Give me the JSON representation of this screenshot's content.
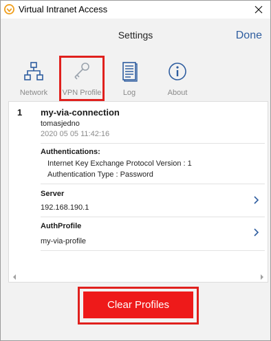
{
  "window": {
    "title": "Virtual Intranet Access"
  },
  "header": {
    "title": "Settings",
    "done_label": "Done"
  },
  "nav": {
    "tabs": [
      {
        "label": "Network",
        "icon": "network-icon"
      },
      {
        "label": "VPN Profile",
        "icon": "key-icon"
      },
      {
        "label": "Log",
        "icon": "log-icon"
      },
      {
        "label": "About",
        "icon": "info-icon"
      }
    ],
    "selected": "VPN Profile"
  },
  "profile": {
    "index": "1",
    "name": "my-via-connection",
    "user": "tomasjedno",
    "date": "2020 05 05 11:42:16",
    "authentications": {
      "heading": "Authentications:",
      "lines": [
        "Internet Key Exchange Protocol Version :  1",
        "Authentication Type :  Password"
      ]
    },
    "server": {
      "heading": "Server",
      "value": "192.168.190.1"
    },
    "auth_profile": {
      "heading": "AuthProfile",
      "value": "my-via-profile"
    }
  },
  "actions": {
    "clear_label": "Clear Profiles"
  },
  "colors": {
    "accent_blue": "#2e5d9f",
    "highlight_red": "#e0201d",
    "button_red": "#ee1a1a",
    "app_icon_orange": "#f0a020"
  }
}
